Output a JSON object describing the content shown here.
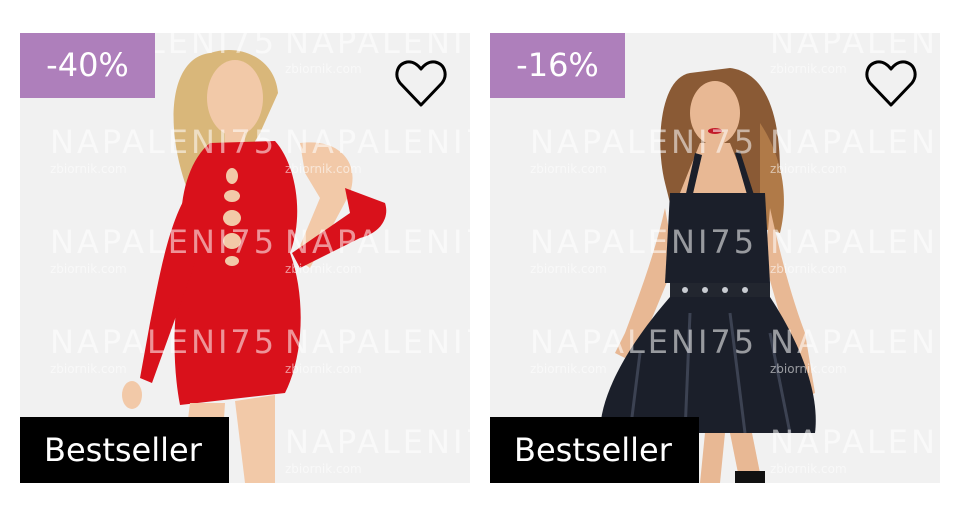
{
  "products": [
    {
      "discount": "-40%",
      "label": "Bestseller",
      "badge_color": "#ae7fbb",
      "dress_color": "#d9111b"
    },
    {
      "discount": "-16%",
      "label": "Bestseller",
      "badge_color": "#ae7fbb",
      "dress_color": "#1b1f2a"
    }
  ],
  "watermark": {
    "line1": "NAPALENI75",
    "line2": "zbiornik.com"
  },
  "icons": {
    "favorite": "heart-outline-icon"
  }
}
